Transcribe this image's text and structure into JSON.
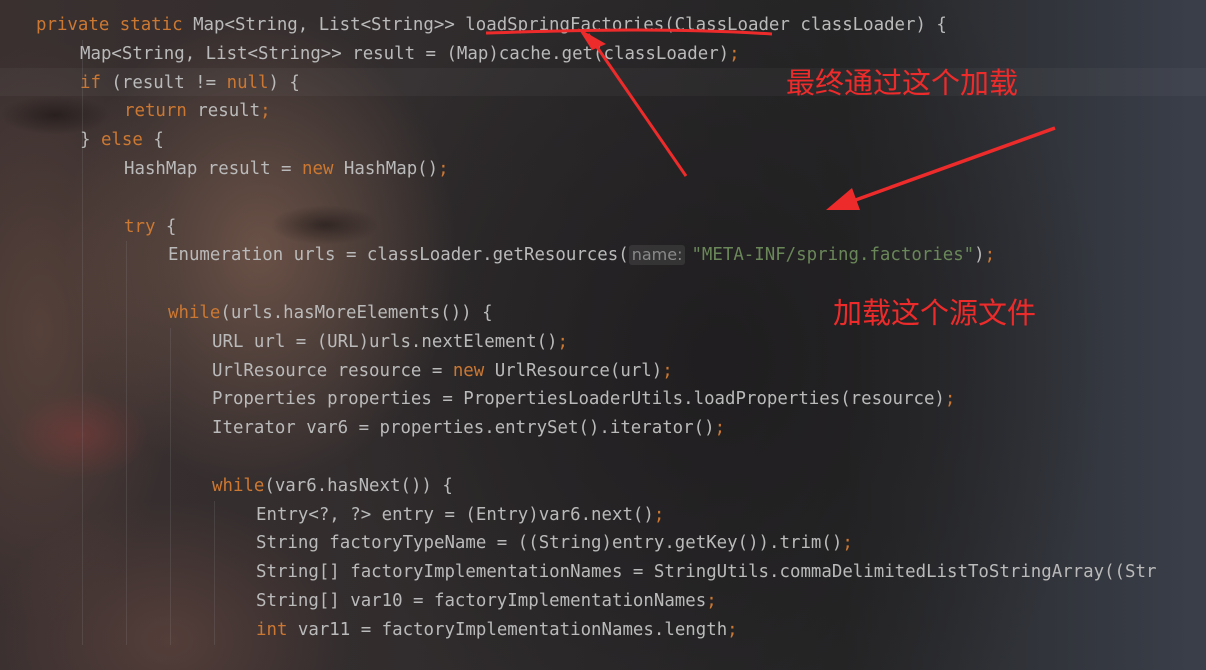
{
  "editor": {
    "lines": [
      {
        "indent": 0,
        "parts": [
          {
            "t": "private static ",
            "c": "kw"
          },
          {
            "t": "Map<String, List<String>> loadSpringFactories(ClassLoader classLoader) {",
            "c": ""
          }
        ]
      },
      {
        "indent": 1,
        "parts": [
          {
            "t": "Map<String, List<String>> result = (Map)cache.get(classLoader)",
            "c": ""
          },
          {
            "t": ";",
            "c": "kw"
          }
        ]
      },
      {
        "indent": 1,
        "parts": [
          {
            "t": "if",
            "c": "kw"
          },
          {
            "t": " (result != ",
            "c": ""
          },
          {
            "t": "null",
            "c": "kw"
          },
          {
            "t": ") {",
            "c": ""
          }
        ]
      },
      {
        "indent": 2,
        "parts": [
          {
            "t": "return",
            "c": "kw"
          },
          {
            "t": " result",
            "c": ""
          },
          {
            "t": ";",
            "c": "kw"
          }
        ]
      },
      {
        "indent": 1,
        "parts": [
          {
            "t": "} ",
            "c": ""
          },
          {
            "t": "else",
            "c": "kw"
          },
          {
            "t": " {",
            "c": ""
          }
        ]
      },
      {
        "indent": 2,
        "parts": [
          {
            "t": "HashMap result = ",
            "c": ""
          },
          {
            "t": "new",
            "c": "kw"
          },
          {
            "t": " HashMap()",
            "c": ""
          },
          {
            "t": ";",
            "c": "kw"
          }
        ]
      },
      {
        "indent": 0,
        "parts": []
      },
      {
        "indent": 2,
        "parts": [
          {
            "t": "try",
            "c": "kw"
          },
          {
            "t": " {",
            "c": ""
          }
        ]
      },
      {
        "indent": 3,
        "parts": [
          {
            "t": "Enumeration urls = classLoader.getResources(",
            "c": ""
          },
          {
            "t": "name:",
            "c": "hint"
          },
          {
            "t": "\"META-INF/spring.factories\"",
            "c": "str"
          },
          {
            "t": ")",
            "c": ""
          },
          {
            "t": ";",
            "c": "kw"
          }
        ]
      },
      {
        "indent": 0,
        "parts": []
      },
      {
        "indent": 3,
        "parts": [
          {
            "t": "while",
            "c": "kw"
          },
          {
            "t": "(urls.hasMoreElements()) {",
            "c": ""
          }
        ]
      },
      {
        "indent": 4,
        "parts": [
          {
            "t": "URL url = (URL)urls.nextElement()",
            "c": ""
          },
          {
            "t": ";",
            "c": "kw"
          }
        ]
      },
      {
        "indent": 4,
        "parts": [
          {
            "t": "UrlResource resource = ",
            "c": ""
          },
          {
            "t": "new",
            "c": "kw"
          },
          {
            "t": " UrlResource(url)",
            "c": ""
          },
          {
            "t": ";",
            "c": "kw"
          }
        ]
      },
      {
        "indent": 4,
        "parts": [
          {
            "t": "Properties properties = PropertiesLoaderUtils.loadProperties(resource)",
            "c": ""
          },
          {
            "t": ";",
            "c": "kw"
          }
        ]
      },
      {
        "indent": 4,
        "parts": [
          {
            "t": "Iterator var6 = properties.entrySet().iterator()",
            "c": ""
          },
          {
            "t": ";",
            "c": "kw"
          }
        ]
      },
      {
        "indent": 0,
        "parts": []
      },
      {
        "indent": 4,
        "parts": [
          {
            "t": "while",
            "c": "kw"
          },
          {
            "t": "(var6.hasNext()) {",
            "c": ""
          }
        ]
      },
      {
        "indent": 5,
        "parts": [
          {
            "t": "Entry<?, ?> entry = (Entry)var6.next()",
            "c": ""
          },
          {
            "t": ";",
            "c": "kw"
          }
        ]
      },
      {
        "indent": 5,
        "parts": [
          {
            "t": "String factoryTypeName = ((String)entry.getKey()).trim()",
            "c": ""
          },
          {
            "t": ";",
            "c": "kw"
          }
        ]
      },
      {
        "indent": 5,
        "parts": [
          {
            "t": "String[] factoryImplementationNames = StringUtils.commaDelimitedListToStringArray((Str",
            "c": ""
          }
        ]
      },
      {
        "indent": 5,
        "parts": [
          {
            "t": "String[] var10 = factoryImplementationNames",
            "c": ""
          },
          {
            "t": ";",
            "c": "kw"
          }
        ]
      },
      {
        "indent": 5,
        "parts": [
          {
            "t": "int",
            "c": "kw"
          },
          {
            "t": " var11 = factoryImplementationNames.length",
            "c": ""
          },
          {
            "t": ";",
            "c": "kw"
          }
        ]
      }
    ]
  },
  "annotations": {
    "note1": "最终通过这个加载",
    "note2": "加载这个源文件",
    "color": "#ee2b2b"
  },
  "colors": {
    "keyword": "#cc7832",
    "string": "#6a8759",
    "text": "#bababa"
  }
}
